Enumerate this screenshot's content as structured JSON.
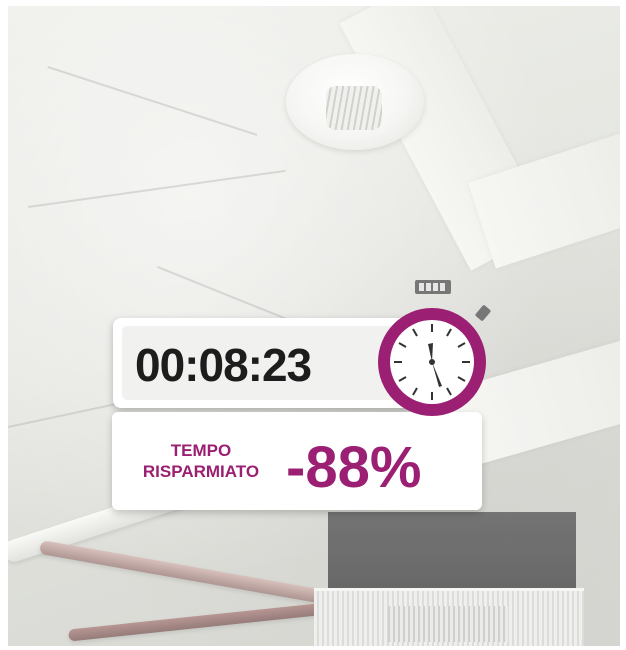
{
  "timer": {
    "value": "00:08:23"
  },
  "savings": {
    "label_line1": "TEMPO",
    "label_line2": "RISPARMIATO",
    "value": "-88%"
  },
  "icons": {
    "stopwatch": "stopwatch-icon"
  },
  "colors": {
    "accent": "#9b1f72",
    "timer_text": "#1d1d1d"
  }
}
